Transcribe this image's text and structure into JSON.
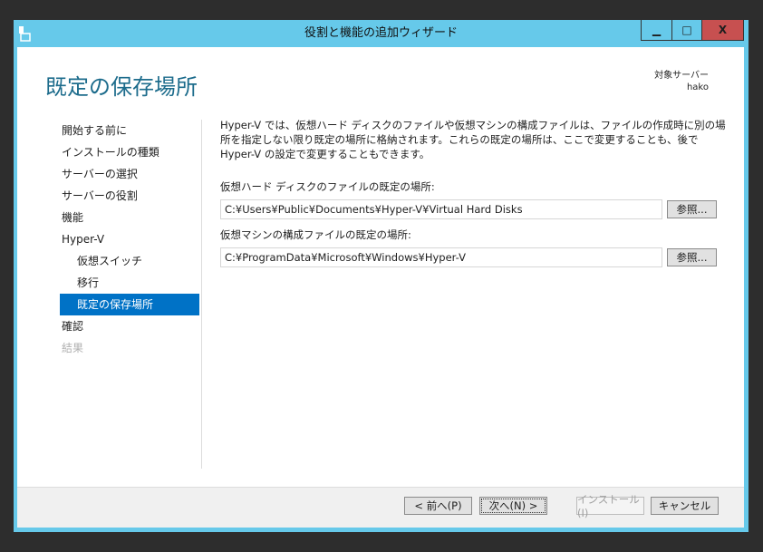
{
  "window": {
    "title": "役割と機能の追加ウィザード",
    "minimize": "▁",
    "maximize": "□",
    "close": "X"
  },
  "header": {
    "page_title": "既定の保存場所",
    "target_label": "対象サーバー",
    "target_server": "hako"
  },
  "nav": {
    "items": [
      {
        "label": "開始する前に",
        "state": "normal"
      },
      {
        "label": "インストールの種類",
        "state": "normal"
      },
      {
        "label": "サーバーの選択",
        "state": "normal"
      },
      {
        "label": "サーバーの役割",
        "state": "normal"
      },
      {
        "label": "機能",
        "state": "normal"
      },
      {
        "label": "Hyper-V",
        "state": "normal"
      },
      {
        "label": "仮想スイッチ",
        "state": "sub"
      },
      {
        "label": "移行",
        "state": "sub"
      },
      {
        "label": "既定の保存場所",
        "state": "selected"
      },
      {
        "label": "確認",
        "state": "normal"
      },
      {
        "label": "結果",
        "state": "disabled"
      }
    ]
  },
  "main": {
    "description": "Hyper-V では、仮想ハード ディスクのファイルや仮想マシンの構成ファイルは、ファイルの作成時に別の場所を指定しない限り既定の場所に格納されます。これらの既定の場所は、ここで変更することも、後で Hyper-V の設定で変更することもできます。",
    "vhd_label": "仮想ハード ディスクのファイルの既定の場所:",
    "vhd_path": "C:¥Users¥Public¥Documents¥Hyper-V¥Virtual Hard Disks",
    "vm_label": "仮想マシンの構成ファイルの既定の場所:",
    "vm_path": "C:¥ProgramData¥Microsoft¥Windows¥Hyper-V",
    "browse": "参照..."
  },
  "footer": {
    "prev": "< 前へ(P)",
    "next": "次へ(N) >",
    "install": "インストール(I)",
    "cancel": "キャンセル"
  }
}
